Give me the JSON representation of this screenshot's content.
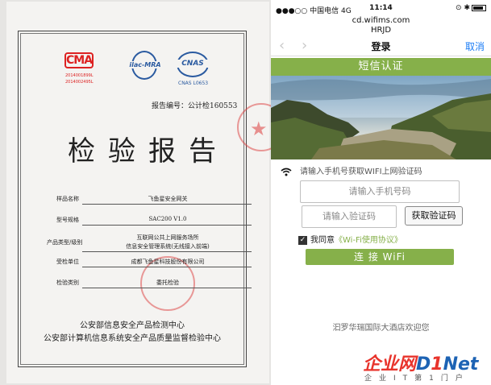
{
  "report": {
    "cma_logo": "CMA",
    "cma_number_1": "2014001899L",
    "cma_number_2": "2014002495L",
    "ilac_logo": "ilac-MRA",
    "ilac_sub": "",
    "cnas_logo": "CNAS",
    "cnas_number": "CNAS L0653",
    "report_number": "报告编号：公计检160553",
    "title": "检验报告",
    "rows": [
      {
        "label": "样品名称",
        "value": "飞鱼星安全网关"
      },
      {
        "label": "型号规格",
        "value": "SAC200 V1.0"
      },
      {
        "label": "产品类型/级别",
        "value": "互联网公共上网服务场所",
        "value2": "信息安全管理系统(无线接入前端)"
      },
      {
        "label": "受检单位",
        "value": "成都飞鱼星科技股份有限公司"
      },
      {
        "label": "检验类别",
        "value": "委托检验"
      }
    ],
    "footer_line1": "公安部信息安全产品检测中心",
    "footer_line2": "公安部计算机信息系统安全产品质量监督检验中心"
  },
  "phone": {
    "status": {
      "carrier": "●●●○○ 中国电信  4G",
      "time": "11:14",
      "right_icons": "⊙ ✱"
    },
    "url": "cd.wifims.com",
    "page_name": "HRJD",
    "nav": {
      "back": "‹",
      "forward": "›",
      "title": "登录",
      "cancel": "取消"
    },
    "banner": "短信认证",
    "wifi_hint": "请输入手机号获取WIFI上网验证码",
    "phone_placeholder": "请输入手机号码",
    "code_placeholder": "请输入验证码",
    "get_code_button": "获取验证码",
    "agree_prefix": "我同意",
    "agree_link": "《Wi-Fi使用协议》",
    "connect_button": "连 接 WiFi",
    "welcome": "汩罗华瑞国际大酒店欢迎您"
  },
  "watermark": {
    "main_cn": "企业网",
    "main_d": "D",
    "main_one": "1",
    "main_net": "Net",
    "sub": "企业IT第1门户"
  },
  "colors": {
    "accent_green": "#86b04a",
    "ios_blue": "#1b7cf5",
    "cma_red": "#dd2222",
    "cnas_blue": "#2a5aa0"
  }
}
